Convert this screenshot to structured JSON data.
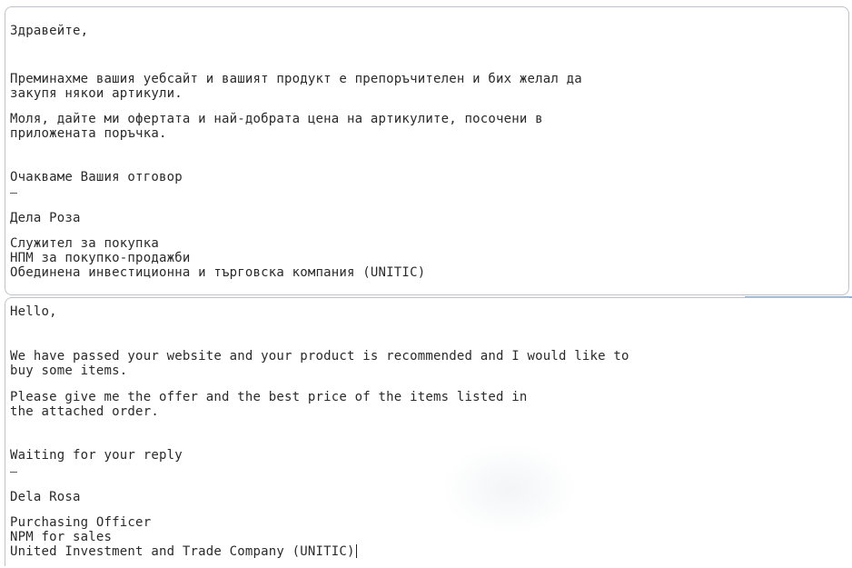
{
  "bulgarian": {
    "greeting": "Здравейте,",
    "para1_line1": "Преминахме вашия уебсайт и вашият продукт е препоръчителен и бих желал да",
    "para1_line2": "закупя някои артикули.",
    "para2_line1": "Моля, дайте ми офертата и най-добрата цена на артикулите, посочени в",
    "para2_line2": "приложената поръчка.",
    "closing": "Очакваме Вашия отговор",
    "name": "Дела Роза",
    "title": "Служител за покупка",
    "department": "НПМ за покупко-продажби",
    "company": "Обединена инвестиционна и търговска компания (UNITIC)"
  },
  "english": {
    "greeting": "Hello,",
    "para1_line1": "We have passed your website and your product is recommended and I would like to",
    "para1_line2": "buy some items.",
    "para2_line1": "Please give me the offer and the best price of the items listed in",
    "para2_line2": "the attached order.",
    "closing": "Waiting for your reply",
    "name": "Dela Rosa",
    "title": "Purchasing Officer",
    "department": "NPM for sales",
    "company": "United Investment and Trade Company (UNITIC)"
  }
}
